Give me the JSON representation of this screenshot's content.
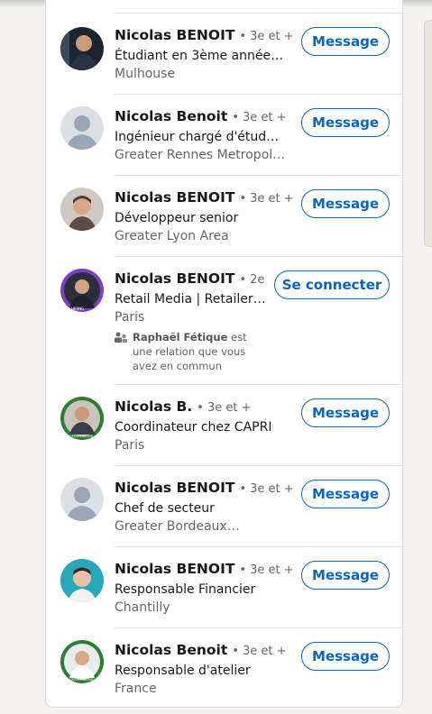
{
  "people": [
    {
      "name": "Nicolas BENOIT",
      "degree": "• 3e et +",
      "headline": "Étudiant en 3ème année de…",
      "location": "Mulhouse",
      "action": "Message",
      "avatar": "photo"
    },
    {
      "name": "Nicolas Benoit",
      "degree": "• 3e et +",
      "headline": "Ingénieur chargé d'études…",
      "location": "Greater Rennes Metropolita…",
      "action": "Message",
      "avatar": "default"
    },
    {
      "name": "Nicolas BENOIT",
      "degree": "• 3e et +",
      "headline": "Développeur senior",
      "location": "Greater Lyon Area",
      "action": "Message",
      "avatar": "photo"
    },
    {
      "name": "Nicolas BENOIT",
      "degree": "• 2e",
      "headline": "Retail Media | Retailers…",
      "location": "Paris",
      "action": "Se connecter",
      "avatar": "photo-hiring",
      "badge": "HIRING",
      "mutual": {
        "bold": "Raphaël Fétique",
        "text": " est une relation que vous avez en commun"
      }
    },
    {
      "name": "Nicolas B.",
      "degree": "• 3e et +",
      "headline": "Coordinateur chez CAPRI",
      "location": "Paris",
      "action": "Message",
      "avatar": "photo-opentowork",
      "badge": "#OPENTOWORK"
    },
    {
      "name": "Nicolas BENOIT",
      "degree": "• 3e et +",
      "headline": "Chef de secteur",
      "location": "Greater Bordeaux…",
      "action": "Message",
      "avatar": "default"
    },
    {
      "name": "Nicolas BENOIT",
      "degree": "• 3e et +",
      "headline": "Responsable Financier",
      "location": "Chantilly",
      "action": "Message",
      "avatar": "photo"
    },
    {
      "name": "Nicolas Benoit",
      "degree": "• 3e et +",
      "headline": "Responsable d'atelier",
      "location": "France",
      "action": "Message",
      "avatar": "photo-opentowork",
      "badge": "#OPENTOWORK"
    }
  ],
  "colors": {
    "accent": "#0a66c2",
    "hiring": "#7c3fc3",
    "opentowork": "#2e7d32"
  }
}
